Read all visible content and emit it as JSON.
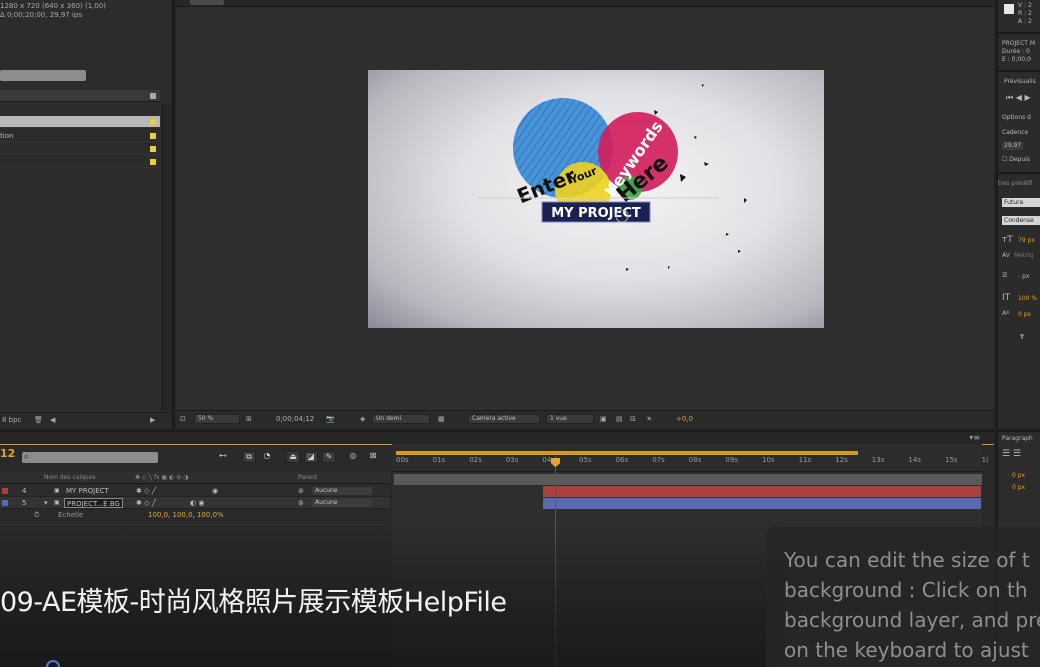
{
  "project_panel": {
    "comp_size": "1280 x 720  (640 x 360) (1,00)",
    "comp_info": "Δ 0;00;20;00, 29,97 ips",
    "row_selected": "",
    "row_label": "tion",
    "bpc": "8 bpc"
  },
  "viewer": {
    "zoom": "50 %",
    "timecode": "0;00;04;12",
    "resolution": "Un demi",
    "camera": "Caméra active",
    "views": "1 vue",
    "exposure": "+0,0",
    "title_text": "MY PROJECT",
    "words": {
      "enter": "Enter",
      "your": "Your",
      "keywords": "Keywords",
      "here": "Here"
    }
  },
  "right_panel": {
    "color_v": "V : 2",
    "color_r": "R : 2",
    "color_a": "A : 2",
    "project_name": "PROJECT M",
    "duration": "Durée : 0",
    "e_value": "E : 0;00;0",
    "preview_title": "Prévisualis",
    "options": "Options d",
    "cadence": "Cadence",
    "cadence_value": "29,97",
    "depuis": "Depuis",
    "presets": "tres prédéfi",
    "font": "Futura",
    "font_style": "Condense",
    "font_size": "79 px",
    "metrics": "Métriq",
    "leading": "- px",
    "scale": "100 %",
    "baseline": "0 px",
    "t_label": "T"
  },
  "timeline": {
    "timecode": "12",
    "columns": {
      "layer_name": "Nom des calques",
      "parent": "Parent"
    },
    "layers": [
      {
        "num": "4",
        "name": "MY PROJECT",
        "parent": "Aucune"
      },
      {
        "num": "5",
        "name": "PROJECT...E BG",
        "parent": "Aucune"
      }
    ],
    "property": {
      "name": "Echelle",
      "value": "100,0, 100,0, 100,0%"
    },
    "ticks": [
      "00s",
      "01s",
      "02s",
      "03s",
      "04s",
      "05s",
      "06s",
      "07s",
      "08s",
      "09s",
      "10s",
      "11s",
      "12s",
      "13s",
      "14s",
      "15s",
      "1("
    ]
  },
  "paragraph_panel": {
    "title": "Paragraph",
    "indent1": "0 px",
    "indent2": "0 px"
  },
  "overlay": {
    "caption": "09-AE模板-时尚风格照片展示模板HelpFile",
    "help_lines": [
      "You can edit the size of t",
      "background : Click on th",
      "background layer, and pre",
      "on the keyboard to ajust"
    ]
  },
  "colors": {
    "accent": "#e1a62a",
    "blue_circle": "#2e8fd8",
    "pink_circle": "#d21f5c",
    "yellow_circle": "#f0d21e",
    "track_red": "#a9413f",
    "track_blue": "#5b68b4"
  }
}
